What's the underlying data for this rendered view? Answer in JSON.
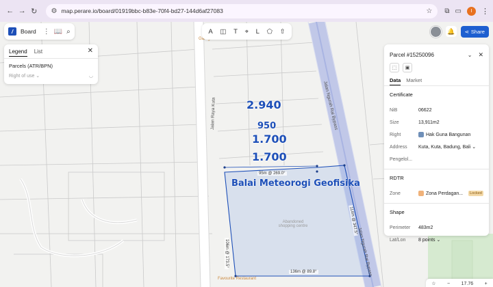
{
  "browser": {
    "url": "map.perare.io/board/01919bbc-b83e-70f4-bd27-144d6af27083",
    "profile_initial": "I",
    "back_icon": "←",
    "forward_icon": "→",
    "reload_icon": "↻",
    "tune_icon": "⚙",
    "star_icon": "☆",
    "extensions_icon": "⧉",
    "sidepanel_icon": "▭",
    "menu_icon": "⋮"
  },
  "toolbar_left": {
    "board_label": "Board",
    "logo_text": "/",
    "menu_icon": "⋮",
    "book_icon": "📖",
    "search_icon": "⌕"
  },
  "toolbar_center": {
    "tools": [
      {
        "name": "text-tool-icon",
        "glyph": "A"
      },
      {
        "name": "note-tool-icon",
        "glyph": "◫"
      },
      {
        "name": "title-tool-icon",
        "glyph": "T"
      },
      {
        "name": "pin-tool-icon",
        "glyph": "⌖"
      },
      {
        "name": "measure-tool-icon",
        "glyph": "L"
      },
      {
        "name": "shape-tool-icon",
        "glyph": "⬠"
      },
      {
        "name": "upload-tool-icon",
        "glyph": "⇧"
      }
    ]
  },
  "toolbar_right": {
    "share_label": "Share",
    "share_icon": "⋖",
    "bell_icon": "🔔"
  },
  "legend": {
    "tab_legend": "Legend",
    "tab_list": "List",
    "close_icon": "✕",
    "layer": "Parcels (ATR/BPN)",
    "right_of_use": "Right of use ⌄",
    "eye_icon": "◡"
  },
  "map": {
    "parcel_numbers": [
      "2.940",
      "950",
      "1.700",
      "1.700"
    ],
    "building_name": "Balai Meteorogi Geofisika",
    "dimensions": {
      "top": "95m @ 269.0°",
      "bottom": "136m @ 89.8°",
      "left": "106m @ 173.5°",
      "right": "114m @ 347.5°"
    },
    "roads": [
      "Jalan Raya Kuta",
      "Jalan Ngurah Rai Bypass",
      "Jalan Ngurah Rai Bypass"
    ],
    "poi": "Abandoned shopping centre",
    "top_orange_label": "Garage",
    "bottom_orange_label": "Favourite Restaurant"
  },
  "panel": {
    "title": "Parcel #15250096",
    "tab_data": "Data",
    "tab_market": "Market",
    "section_certificate": "Certificate",
    "section_rdtr": "RDTR",
    "section_shape": "Shape",
    "nib_label": "NiB",
    "nib_value": "06622",
    "size_label": "Size",
    "size_value": "13,911m2",
    "right_label": "Right",
    "right_value": "Hak Guna Bangunan",
    "address_label": "Address",
    "address_value": "Kuta, Kuta, Badung, Bali ⌄",
    "pengelola_label": "Pengelol...",
    "zone_label": "Zone",
    "zone_value": "Zona Perdagan...",
    "zone_locked": "Locked",
    "perimeter_label": "Perimeter",
    "perimeter_value": "483m2",
    "latlon_label": "Lat/Lon",
    "latlon_value": "8 points ⌄",
    "collapse_icon": "⌄",
    "close_icon": "✕"
  },
  "zoom": {
    "level": "17.76",
    "minus": "−",
    "plus": "+"
  },
  "colors": {
    "accent": "#1d4fb8",
    "share": "#1d5fd0",
    "parcel_blue": "#1d4fb8",
    "road": "#a8b4e0"
  }
}
